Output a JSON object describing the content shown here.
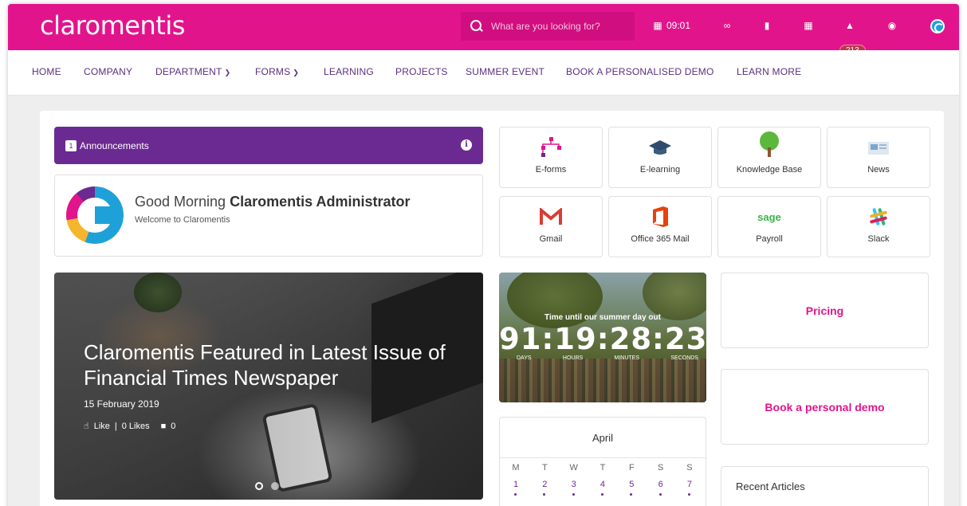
{
  "header": {
    "logo": "claromentis",
    "search_placeholder": "What are you looking for?",
    "clock": "09:01",
    "notifications_count": "213"
  },
  "nav": {
    "items": [
      {
        "label": "HOME",
        "dropdown": false
      },
      {
        "label": "COMPANY",
        "dropdown": false
      },
      {
        "label": "DEPARTMENT",
        "dropdown": true
      },
      {
        "label": "FORMS",
        "dropdown": true
      },
      {
        "label": "LEARNING",
        "dropdown": false
      },
      {
        "label": "PROJECTS",
        "dropdown": false
      },
      {
        "label": "SUMMER EVENT",
        "dropdown": false
      },
      {
        "label": "BOOK A PERSONALISED DEMO",
        "dropdown": false
      },
      {
        "label": "LEARN MORE",
        "dropdown": false
      }
    ]
  },
  "announcements": {
    "count": "1",
    "label": "Announcements"
  },
  "greeting": {
    "prefix": "Good Morning",
    "name": "Claromentis Administrator",
    "subtitle": "Welcome to Claromentis"
  },
  "hero": {
    "title": "Claromentis Featured in Latest Issue of Financial Times Newspaper",
    "date": "15 February 2019",
    "like_label": "Like",
    "likes": "0 Likes",
    "comments": "0"
  },
  "apps": [
    {
      "label": "E-forms",
      "icon": "eforms-icon"
    },
    {
      "label": "E-learning",
      "icon": "graduation-cap-icon"
    },
    {
      "label": "Knowledge Base",
      "icon": "tree-icon"
    },
    {
      "label": "News",
      "icon": "newspaper-icon"
    },
    {
      "label": "Gmail",
      "icon": "gmail-icon"
    },
    {
      "label": "Office 365 Mail",
      "icon": "office365-icon"
    },
    {
      "label": "Payroll",
      "icon": "sage-icon",
      "brand": "sage"
    },
    {
      "label": "Slack",
      "icon": "slack-icon"
    }
  ],
  "countdown": {
    "caption": "Time until our summer day out",
    "time": "91:19:28:23",
    "units": [
      "DAYS",
      "HOURS",
      "MINUTES",
      "SECONDS"
    ]
  },
  "calendar": {
    "month": "April",
    "weekdays": [
      "M",
      "T",
      "W",
      "T",
      "F",
      "S",
      "S"
    ],
    "days": [
      "1",
      "2",
      "3",
      "4",
      "5",
      "6",
      "7"
    ]
  },
  "promos": {
    "pricing": "Pricing",
    "demo": "Book a personal demo"
  },
  "recent_articles": {
    "title": "Recent Articles"
  },
  "colors": {
    "brand_pink": "#e2148c",
    "brand_purple": "#6b2a91"
  }
}
